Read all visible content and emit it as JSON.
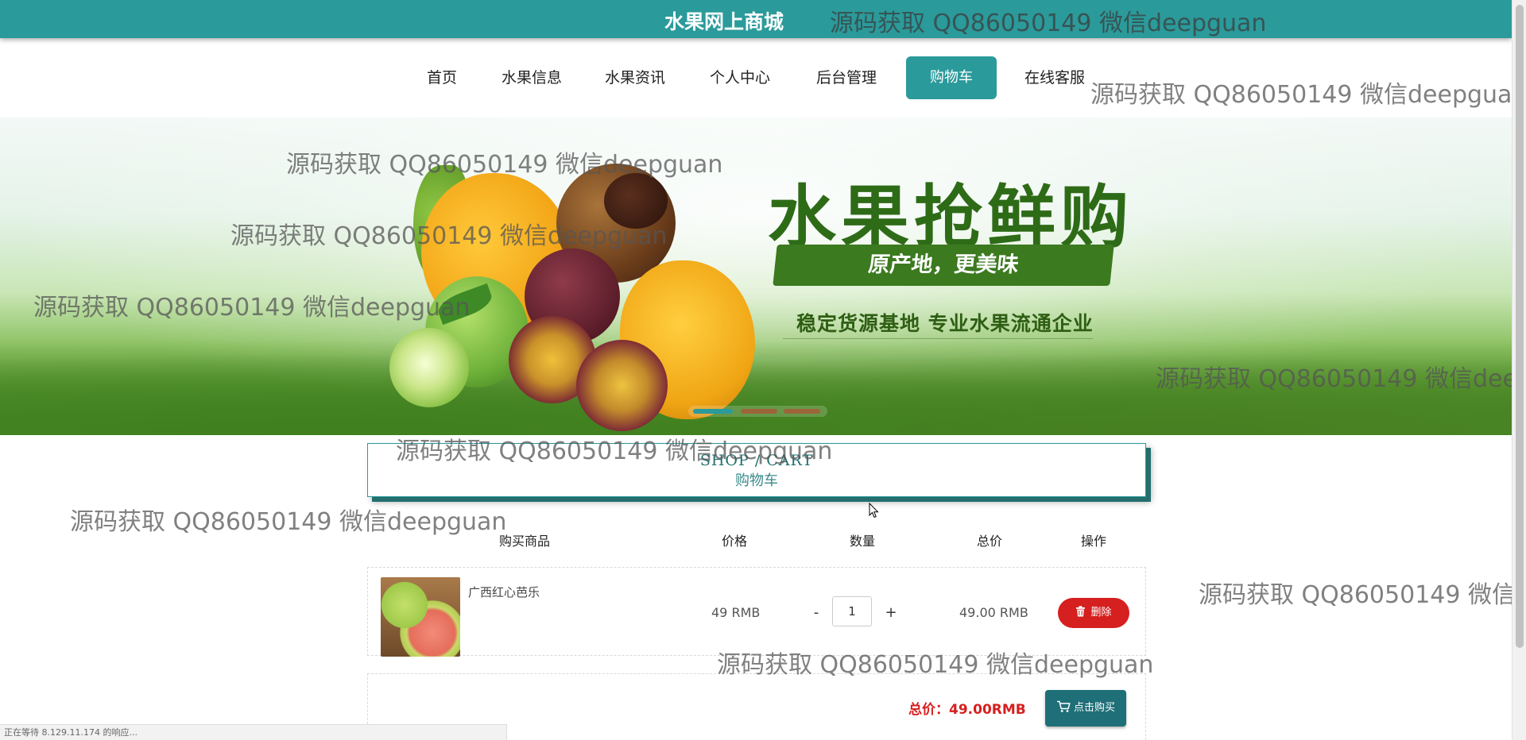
{
  "header": {
    "site_title": "水果网上商城"
  },
  "nav": {
    "items": [
      {
        "label": "首页"
      },
      {
        "label": "水果信息"
      },
      {
        "label": "水果资讯"
      },
      {
        "label": "个人中心"
      },
      {
        "label": "后台管理"
      },
      {
        "label": "购物车",
        "active": true
      },
      {
        "label": "在线客服"
      }
    ]
  },
  "banner": {
    "headline": "水果抢鲜购",
    "subheadline": "原产地，更美味",
    "tagline": "稳定货源基地 专业水果流通企业",
    "carousel_slides": 3,
    "active_slide": 1
  },
  "cart": {
    "title_en": "SHOP / CART",
    "title_cn": "购物车",
    "columns": [
      "购买商品",
      "价格",
      "数量",
      "总价",
      "操作"
    ],
    "items": [
      {
        "name": "广西红心芭乐",
        "price": "49 RMB",
        "quantity": "1",
        "subtotal": "49.00 RMB",
        "delete_label": "删除"
      }
    ],
    "minus_label": "-",
    "plus_label": "+",
    "total_label": "总价：49.00RMB",
    "buy_label": "点击购买"
  },
  "watermark": {
    "text": "源码获取 QQ86050149 微信deepguan"
  },
  "statusbar": {
    "text": "正在等待 8.129.11.174 的响应..."
  },
  "colors": {
    "primary": "#2b9a9b",
    "danger": "#d61f1f",
    "buy_button": "#1f6f78"
  }
}
